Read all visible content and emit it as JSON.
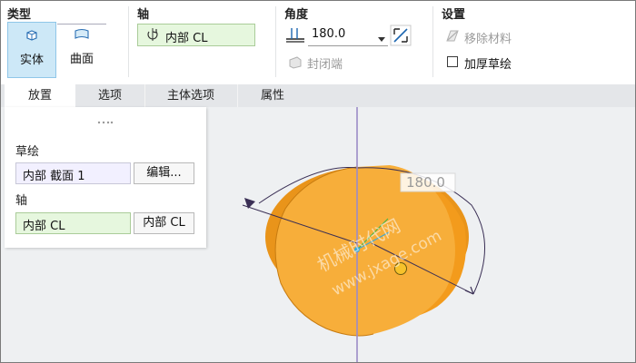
{
  "ribbon": {
    "type_group": {
      "title": "类型",
      "solid_label": "实体",
      "surface_label": "曲面"
    },
    "axis_group": {
      "title": "轴",
      "value": "内部 CL"
    },
    "angle_group": {
      "title": "角度",
      "value": "180.0",
      "capped_label": "封闭端"
    },
    "settings_group": {
      "title": "设置",
      "remove_material_label": "移除材料",
      "thicken_sketch_label": "加厚草绘"
    }
  },
  "tabs": [
    {
      "label": "放置",
      "active": true
    },
    {
      "label": "选项",
      "active": false
    },
    {
      "label": "主体选项",
      "active": false
    },
    {
      "label": "属性",
      "active": false
    }
  ],
  "placement_panel": {
    "sketch_label": "草绘",
    "sketch_value": "内部 截面 1",
    "edit_button": "编辑...",
    "axis_label": "轴",
    "axis_value": "内部 CL",
    "axis_button": "内部 CL"
  },
  "viewport": {
    "angle_tag": "180.0",
    "dim_label_partial": "180.0",
    "watermark_cn": "机械时代网",
    "watermark_url": "www.jxage.com"
  },
  "colors": {
    "accent_blue": "#cde8f7",
    "field_green": "#e6f7de",
    "body_orange": "#f5a623",
    "axis_purple": "#9b8cc8",
    "handle_yellow": "#f7c22b"
  }
}
